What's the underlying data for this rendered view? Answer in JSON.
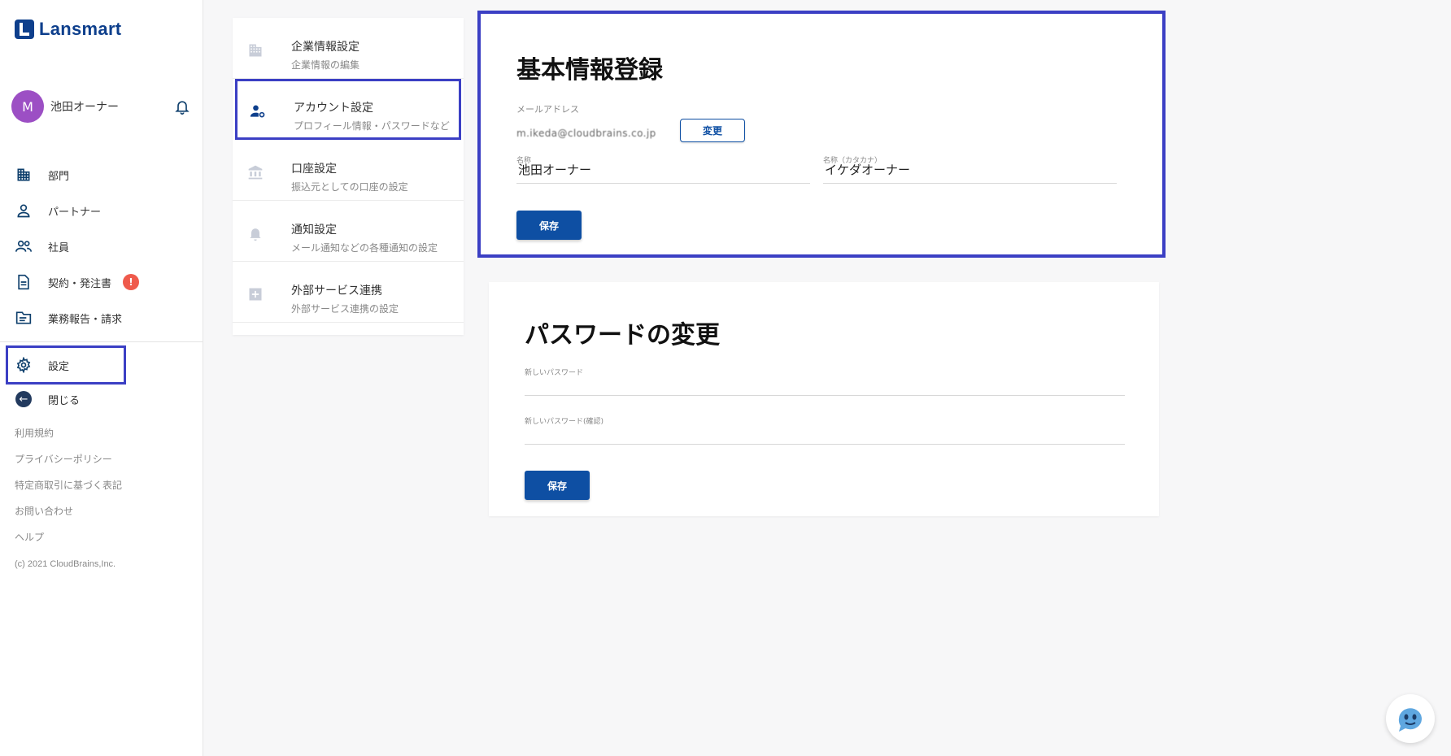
{
  "brand": {
    "name": "Lansmart"
  },
  "user": {
    "initial": "M",
    "name": "池田オーナー"
  },
  "nav": {
    "items": [
      {
        "label": "部門",
        "icon": "building-icon"
      },
      {
        "label": "パートナー",
        "icon": "person-icon"
      },
      {
        "label": "社員",
        "icon": "people-icon"
      },
      {
        "label": "契約・発注書",
        "icon": "document-icon",
        "badge": "!"
      },
      {
        "label": "業務報告・請求",
        "icon": "folder-icon"
      }
    ],
    "settings": "設定",
    "close": "閉じる"
  },
  "links": [
    "利用規約",
    "プライバシーポリシー",
    "特定商取引に基づく表記",
    "お問い合わせ",
    "ヘルプ"
  ],
  "copyright": "(c) 2021 CloudBrains,Inc.",
  "settings_menu": [
    {
      "title": "企業情報設定",
      "sub": "企業情報の編集",
      "icon": "building-icon"
    },
    {
      "title": "アカウント設定",
      "sub": "プロフィール情報・パスワードなど",
      "icon": "user-gear-icon",
      "active": true
    },
    {
      "title": "口座設定",
      "sub": "振込元としての口座の設定",
      "icon": "bank-icon"
    },
    {
      "title": "通知設定",
      "sub": "メール通知などの各種通知の設定",
      "icon": "bell-icon"
    },
    {
      "title": "外部サービス連携",
      "sub": "外部サービス連携の設定",
      "icon": "plus-box-icon"
    }
  ],
  "basic_info": {
    "title": "基本情報登録",
    "email_label": "メールアドレス",
    "email_value": "m.ikeda@cloudbrains.co.jp",
    "change_button": "変更",
    "name_label": "名称",
    "name_value": "池田オーナー",
    "kana_label": "名称（カタカナ）",
    "kana_value": "イケダオーナー",
    "save_button": "保存"
  },
  "password": {
    "title": "パスワードの変更",
    "new_label": "新しいパスワード",
    "confirm_label": "新しいパスワード(確認)",
    "save_button": "保存"
  },
  "colors": {
    "primary": "#0e4fa3",
    "highlight": "#3b3fc4",
    "badge": "#ef5a4c",
    "avatar": "#9c4fc4"
  }
}
